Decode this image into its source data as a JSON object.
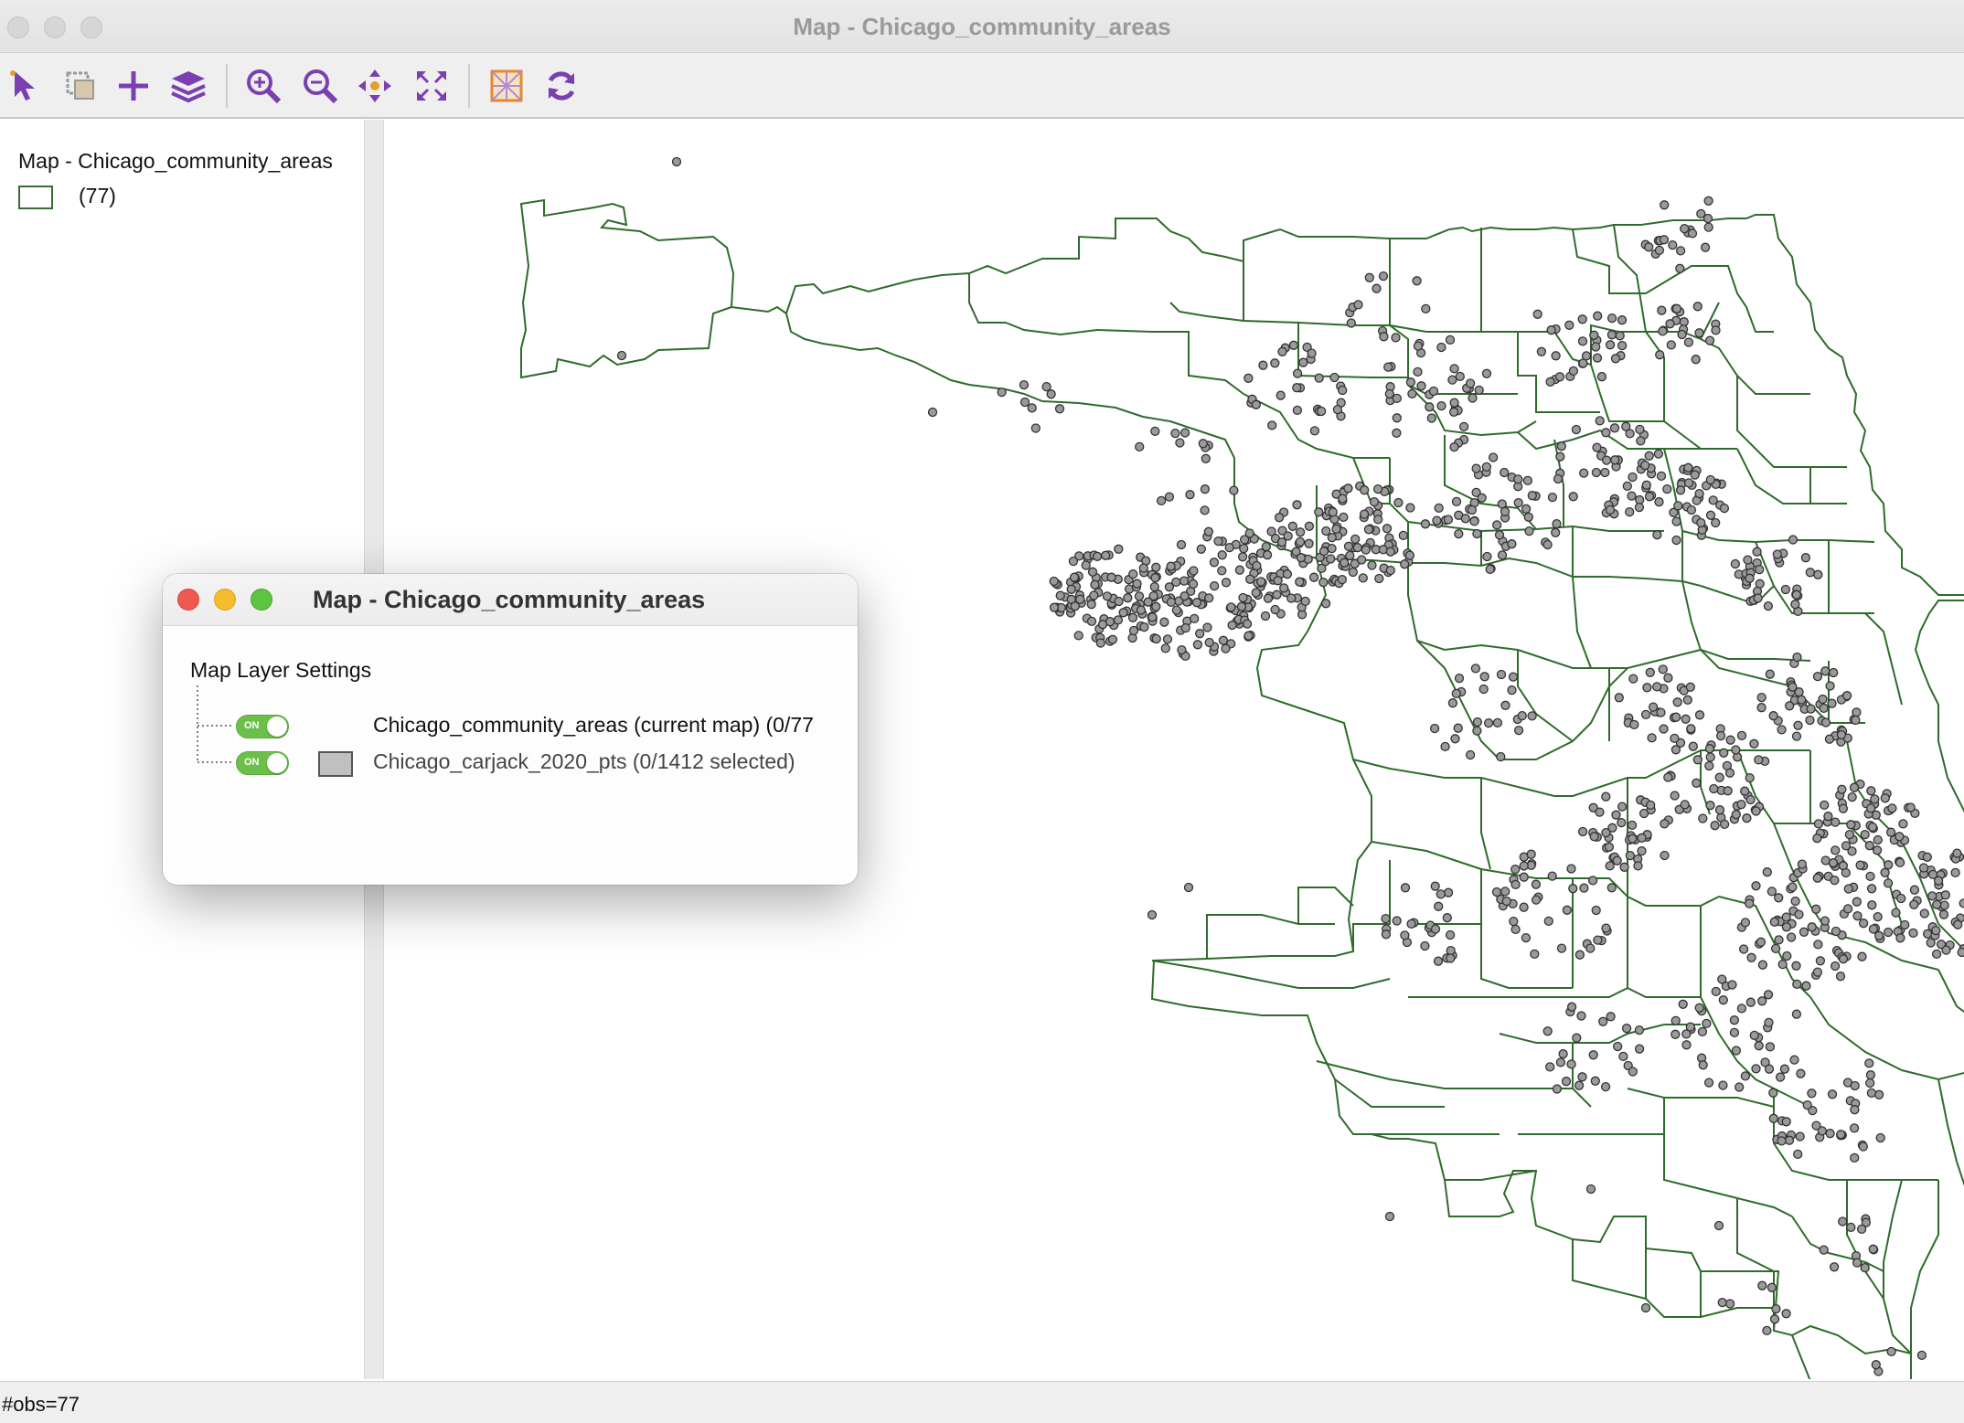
{
  "window": {
    "title": "Map - Chicago_community_areas"
  },
  "toolbar": {
    "tools": [
      {
        "name": "select-pointer-icon",
        "color": "#7a3fb0"
      },
      {
        "name": "selection-shape-icon",
        "color": "#9a9a9a"
      },
      {
        "name": "add-layer-plus-icon",
        "color": "#7a3fb0"
      },
      {
        "name": "layers-icon",
        "color": "#7a3fb0"
      },
      {
        "name": "zoom-in-icon",
        "color": "#7a3fb0"
      },
      {
        "name": "zoom-out-icon",
        "color": "#7a3fb0"
      },
      {
        "name": "pan-icon",
        "color": "#7a3fb0"
      },
      {
        "name": "full-extent-icon",
        "color": "#7a3fb0"
      },
      {
        "name": "basemap-icon",
        "color": "#e08a2a"
      },
      {
        "name": "refresh-icon",
        "color": "#7a3fb0"
      }
    ]
  },
  "legend": {
    "title": "Map - Chicago_community_areas",
    "count_label": "(77)",
    "swatch_border": "#3a6b35"
  },
  "map": {
    "boundary_color": "#2f6b2a",
    "point_fill": "#9a9a9a",
    "point_stroke": "#333333",
    "layers": [
      "Chicago_community_areas",
      "Chicago_carjack_2020_pts"
    ]
  },
  "dialog": {
    "title": "Map - Chicago_community_areas",
    "heading": "Map Layer Settings",
    "layers": [
      {
        "toggle_label": "ON",
        "label": "Chicago_community_areas (current map) (0/77",
        "swatch": false
      },
      {
        "toggle_label": "ON",
        "label": "Chicago_carjack_2020_pts (0/1412 selected)",
        "swatch": true,
        "swatch_color": "#c0c0c0"
      }
    ]
  },
  "statusbar": {
    "text": "#obs=77"
  }
}
